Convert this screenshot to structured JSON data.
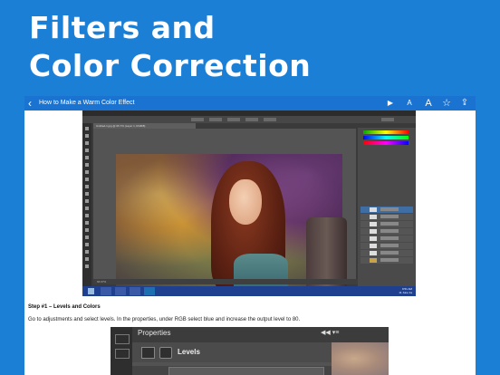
{
  "headline": {
    "line1": "Filters and",
    "line2": "Color Correction"
  },
  "navbar": {
    "back_glyph": "‹",
    "title": "How to Make a Warm Color Effect",
    "icons": {
      "play": "▶",
      "font_small": "A",
      "font_large": "A",
      "bookmark": "☆",
      "share": "⇪"
    }
  },
  "photoshop": {
    "menu": [
      "Ps",
      "File",
      "Edit",
      "Image",
      "Layer",
      "Type",
      "Select",
      "Filter",
      "View",
      "Window",
      "Help"
    ],
    "doc_tab": "Untitled-1.jpg @ 66.7% (Layer 1, RGB/8)",
    "status": "66.67%",
    "clock": {
      "time": "9:51 AM",
      "date": "11 June 1a"
    }
  },
  "article": {
    "step_title": "Step #1 – Levels and Colors",
    "step_text": "Go to adjustments and select levels. In the properties, under RGB select blue and increase the output level to 80."
  },
  "properties_panel": {
    "title": "Properties",
    "controls": "◀◀   ▾≡",
    "section": "Levels"
  }
}
